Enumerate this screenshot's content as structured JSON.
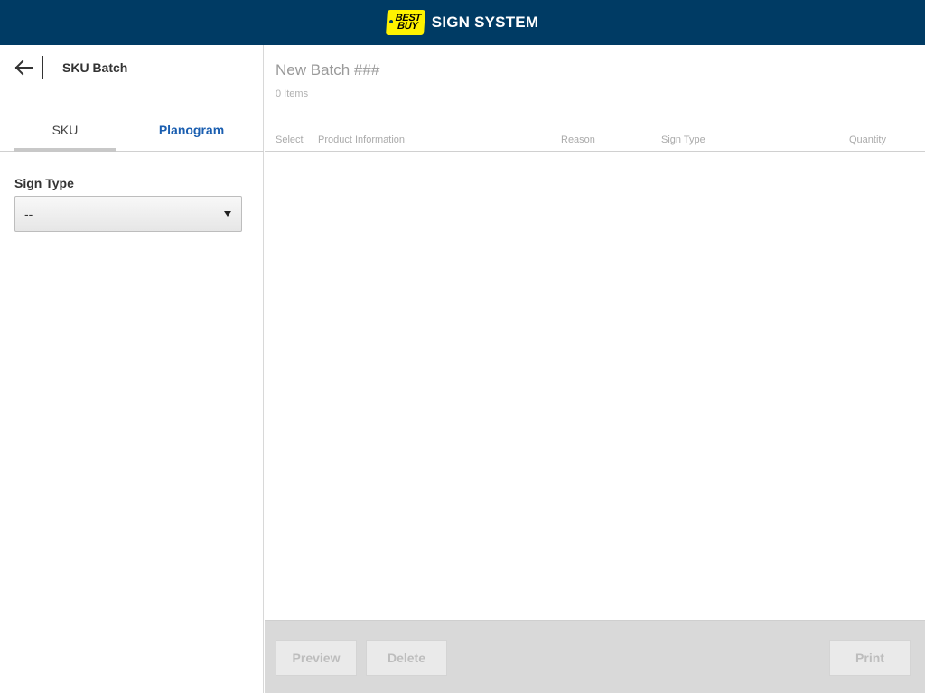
{
  "header": {
    "logo": {
      "line1": "BEST",
      "line2": "BUY",
      "color": "#fff200"
    },
    "title": "SIGN SYSTEM",
    "background_color": "#003b64"
  },
  "sidebar": {
    "back_icon": "arrow-left-icon",
    "title": "SKU Batch",
    "tabs": [
      {
        "label": "SKU",
        "active": true
      },
      {
        "label": "Planogram",
        "active": false
      }
    ],
    "sign_type": {
      "label": "Sign Type",
      "selected_value": "--",
      "arrow_icon": "caret-down-icon"
    }
  },
  "main": {
    "batch_title": "New Batch ###",
    "item_count": "0 Items",
    "columns": [
      "Select",
      "Product Information",
      "Reason",
      "Sign Type",
      "Quantity"
    ],
    "rows": []
  },
  "footer": {
    "preview_label": "Preview",
    "delete_label": "Delete",
    "print_label": "Print"
  },
  "colors": {
    "accent_link": "#1a5eb0",
    "disabled_text": "#bdbdbd"
  }
}
